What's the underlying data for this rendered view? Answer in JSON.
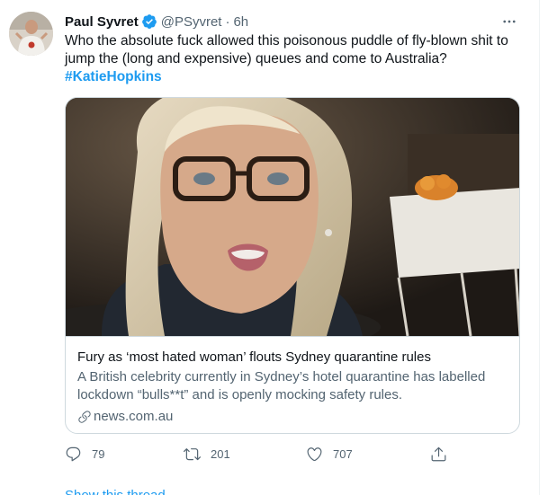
{
  "tweet": {
    "display_name": "Paul Syvret",
    "handle": "@PSyvret",
    "separator": "·",
    "time": "6h",
    "text": "Who the absolute fuck allowed this poisonous puddle of fly-blown shit to jump the (long and expensive) queues and come to Australia?",
    "hashtag": "#KatieHopkins",
    "more_icon": "more-horizontal-icon"
  },
  "card": {
    "title": "Fury as ‘most hated woman’ flouts Sydney quarantine rules",
    "description": "A British celebrity currently in Sydney’s hotel quarantine has labelled lockdown “bulls**t” and is openly mocking safety rules.",
    "domain": "news.com.au"
  },
  "actions": {
    "replies": "79",
    "retweets": "201",
    "likes": "707"
  },
  "show_thread": "Show this thread",
  "colors": {
    "accent": "#1d9bf0",
    "text": "#0f1419",
    "secondary": "#536471",
    "border": "#cfd9de"
  }
}
